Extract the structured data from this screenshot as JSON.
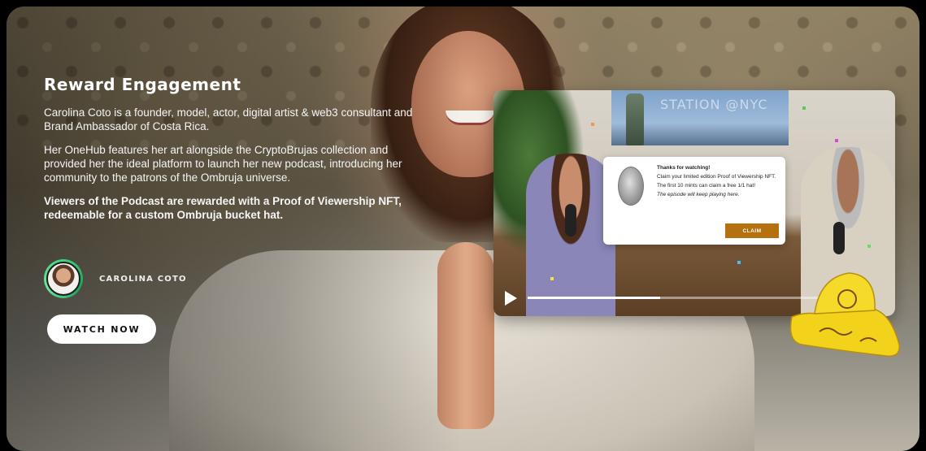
{
  "section": {
    "title": "Reward Engagement",
    "paragraph1": "Carolina Coto is a founder, model, actor, digital artist & web3 consultant and Brand Ambassador of Costa Rica.",
    "paragraph2": "Her OneHub features her art alongside the CryptoBrujas collection and provided her the ideal platform to launch her new podcast, introducing her community to the patrons of the Ombruja universe.",
    "highlight": "Viewers of the Podcast are rewarded with a Proof of Viewership NFT, redeemable for a custom Ombruja bucket hat."
  },
  "author": {
    "name": "CAROLINA COTO"
  },
  "cta": {
    "label": "WATCH NOW"
  },
  "video": {
    "poster_text": "STATION @NYC",
    "progress": 0.43,
    "modal": {
      "title": "Thanks for watching!",
      "line1": "Claim your limited edition Proof of Viewership NFT.",
      "line2": "The first 10 mints can claim a free 1/1 hat!",
      "note": "The episode will keep playing here.",
      "claim_label": "CLAIM"
    }
  },
  "colors": {
    "accent_claim": "#b5700f",
    "avatar_ring": "#3fd37a",
    "hat_yellow": "#f2d21a"
  }
}
